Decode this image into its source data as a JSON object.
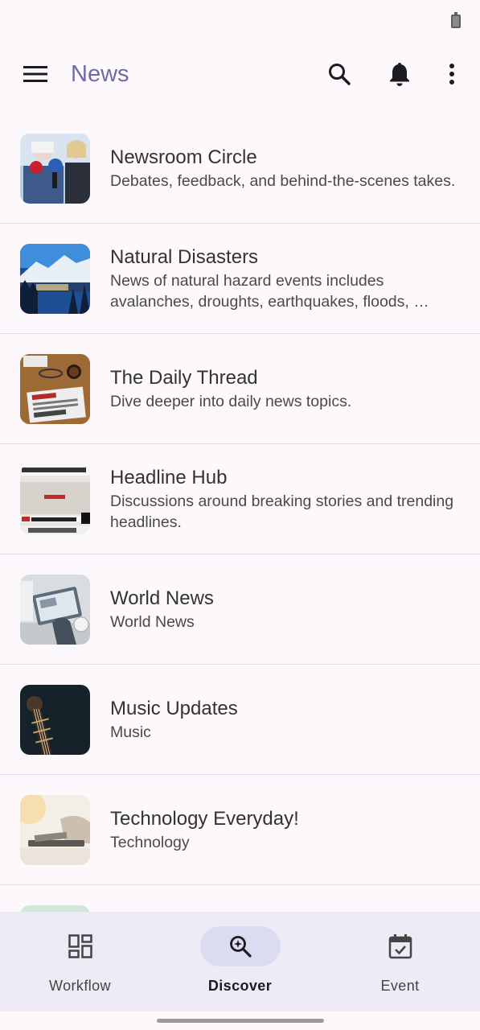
{
  "app_bar": {
    "title": "News"
  },
  "icons": {
    "menu": "menu-icon",
    "search": "search-icon",
    "notifications": "bell-icon",
    "more": "more-vertical-icon"
  },
  "colors": {
    "title": "#6e6aa6",
    "background": "#fcf8fc",
    "nav_background": "#eeeaf6",
    "nav_active_pill": "#dcdcf0"
  },
  "groups": [
    {
      "title": "Newsroom Circle",
      "description": "Debates, feedback, and behind-the-scenes takes."
    },
    {
      "title": "Natural Disasters",
      "description": "News of natural hazard events includes avalanches, droughts, earthquakes, floods, …"
    },
    {
      "title": "The Daily Thread",
      "description": "Dive deeper into daily news topics."
    },
    {
      "title": "Headline Hub",
      "description": "Discussions around breaking stories and trending headlines."
    },
    {
      "title": "World News",
      "description": "World News"
    },
    {
      "title": "Music Updates",
      "description": "Music"
    },
    {
      "title": "Technology Everyday!",
      "description": "Technology"
    }
  ],
  "bottom_nav": {
    "items": [
      {
        "label": "Workflow",
        "icon": "dashboard-icon",
        "active": false
      },
      {
        "label": "Discover",
        "icon": "search-icon",
        "active": true
      },
      {
        "label": "Event",
        "icon": "calendar-check-icon",
        "active": false
      }
    ]
  }
}
